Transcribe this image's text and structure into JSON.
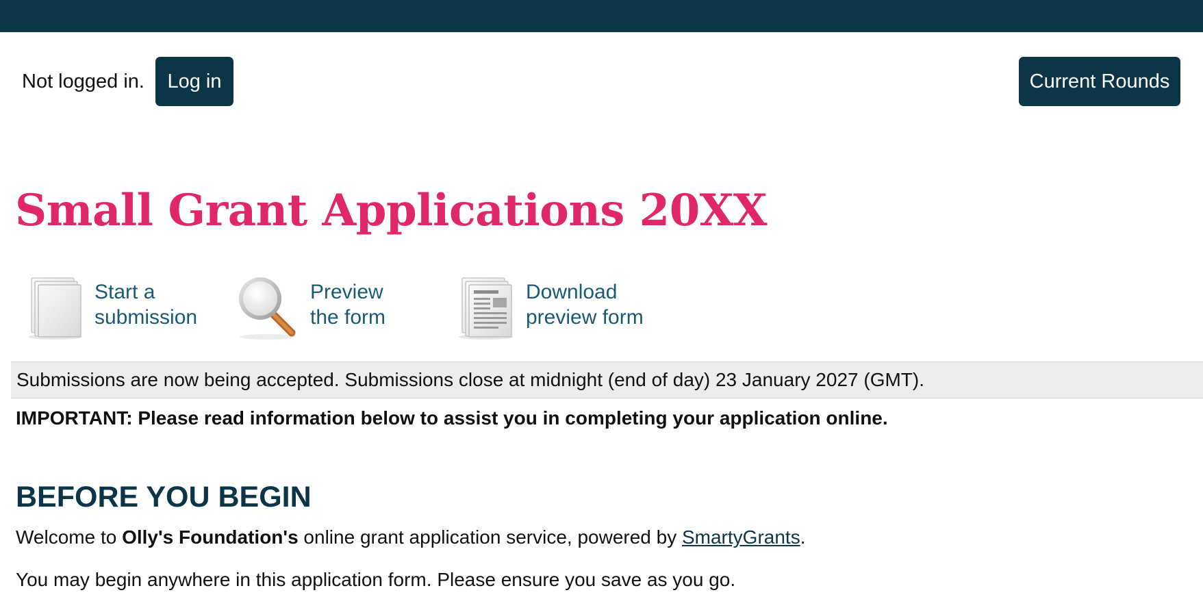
{
  "auth": {
    "status_text": "Not logged in.",
    "login_label": "Log in"
  },
  "nav": {
    "current_rounds_label": "Current Rounds"
  },
  "page": {
    "title": "Small Grant Applications 20XX"
  },
  "actions": [
    {
      "line1": "Start a",
      "line2": "submission",
      "icon": "document-stack-icon"
    },
    {
      "line1": "Preview",
      "line2": "the form",
      "icon": "magnifier-icon"
    },
    {
      "line1": "Download",
      "line2": "preview form",
      "icon": "document-preview-icon"
    }
  ],
  "status": {
    "text": "Submissions are now being accepted. Submissions close at midnight (end of day) 23 January 2027 (GMT)."
  },
  "important": "IMPORTANT: Please read information below to assist you in completing your application online.",
  "section": {
    "heading": "BEFORE YOU BEGIN",
    "welcome_prefix": "Welcome to ",
    "org_name": "Olly's Foundation's",
    "welcome_middle": " online grant application service, powered by ",
    "link_text": "SmartyGrants",
    "welcome_suffix": ".",
    "paragraph2": "You may begin anywhere in this application form. Please ensure you save as you go."
  },
  "colors": {
    "topbar": "#0c3547",
    "button": "#0c3547",
    "title": "#e0276a",
    "link": "#1b5a74",
    "status_bg": "#ededed"
  }
}
